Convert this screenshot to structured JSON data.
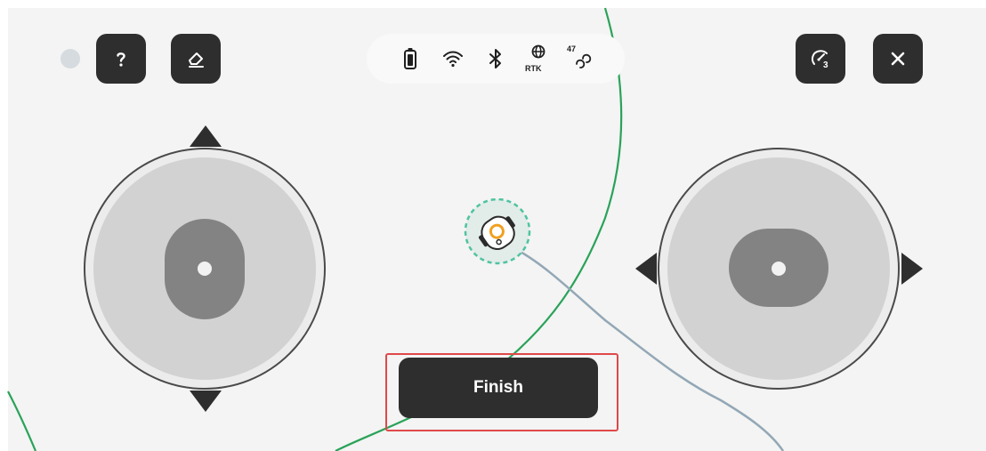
{
  "toolbar_left": {
    "status_indicator_icon": "status-dot",
    "help_button": {
      "label": "?",
      "icon": "help-icon"
    },
    "eraser_button": {
      "icon": "eraser-icon"
    }
  },
  "status_bar": {
    "battery_icon": "battery-icon",
    "wifi_icon": "wifi-icon",
    "bluetooth_icon": "bluetooth-icon",
    "rtk": {
      "icon": "globe-icon",
      "label": "RTK"
    },
    "satellites": {
      "icon": "satellite-link-icon",
      "count": "47"
    }
  },
  "toolbar_right": {
    "speed_button": {
      "icon": "speedometer-icon",
      "level": "3"
    },
    "close_button": {
      "icon": "close-icon"
    }
  },
  "controls": {
    "left_joystick": {
      "icon": "vertical-joystick",
      "directions": [
        "up",
        "down"
      ]
    },
    "right_joystick": {
      "icon": "horizontal-joystick",
      "directions": [
        "left",
        "right"
      ]
    }
  },
  "map": {
    "robot_icon": "mower-robot-icon",
    "boundary_color": "#2aa25a",
    "path_color": "#93a7b6",
    "robot_ring_color": "#4fc3a1"
  },
  "finish_button": {
    "label": "Finish"
  },
  "colors": {
    "button_dark": "#2e2e2e",
    "highlight": "#e0484a",
    "background": "#f3f4f3"
  }
}
